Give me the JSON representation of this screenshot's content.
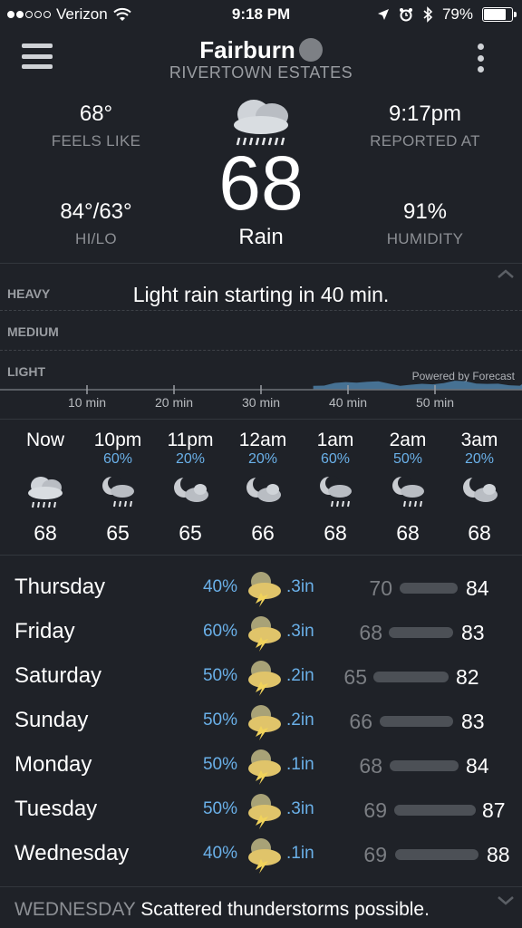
{
  "status_bar": {
    "carrier": "Verizon",
    "time": "9:18 PM",
    "battery": "79%",
    "battery_level": 0.79
  },
  "header": {
    "location": "Fairburn",
    "sublocation": "RIVERTOWN ESTATES"
  },
  "current": {
    "feels_like": {
      "value": "68°",
      "label": "FEELS LIKE"
    },
    "reported_at": {
      "value": "9:17pm",
      "label": "REPORTED AT"
    },
    "hilo": {
      "value": "84°/63°",
      "label": "HI/LO"
    },
    "humidity": {
      "value": "91%",
      "label": "HUMIDITY"
    },
    "temp": "68",
    "condition": "Rain",
    "icon": "rain-cloud-icon"
  },
  "precip_graph": {
    "summary": "Light rain starting in 40 min.",
    "levels": [
      "HEAVY",
      "MEDIUM",
      "LIGHT"
    ],
    "powered_by": "Powered by Forecast",
    "ticks": [
      "10 min",
      "20 min",
      "30 min",
      "40 min",
      "50 min"
    ],
    "intensity_start_min": 36,
    "fill_color": "#4d7fa6"
  },
  "hourly": [
    {
      "time": "Now",
      "precip": "",
      "temp": "68",
      "icon": "rain-cloud-icon"
    },
    {
      "time": "10pm",
      "precip": "60%",
      "temp": "65",
      "icon": "moon-rain-icon"
    },
    {
      "time": "11pm",
      "precip": "20%",
      "temp": "65",
      "icon": "moon-cloud-icon"
    },
    {
      "time": "12am",
      "precip": "20%",
      "temp": "66",
      "icon": "moon-cloud-icon"
    },
    {
      "time": "1am",
      "precip": "60%",
      "temp": "68",
      "icon": "moon-rain-icon"
    },
    {
      "time": "2am",
      "precip": "50%",
      "temp": "68",
      "icon": "moon-rain-icon"
    },
    {
      "time": "3am",
      "precip": "20%",
      "temp": "68",
      "icon": "moon-cloud-icon"
    }
  ],
  "daily": [
    {
      "day": "Thursday",
      "precip": "40%",
      "amount": ".3in",
      "low": "70",
      "high": "84",
      "icon": "storm-icon"
    },
    {
      "day": "Friday",
      "precip": "60%",
      "amount": ".3in",
      "low": "68",
      "high": "83",
      "icon": "storm-icon"
    },
    {
      "day": "Saturday",
      "precip": "50%",
      "amount": ".2in",
      "low": "65",
      "high": "82",
      "icon": "storm-icon"
    },
    {
      "day": "Sunday",
      "precip": "50%",
      "amount": ".2in",
      "low": "66",
      "high": "83",
      "icon": "storm-icon"
    },
    {
      "day": "Monday",
      "precip": "50%",
      "amount": ".1in",
      "low": "68",
      "high": "84",
      "icon": "storm-icon"
    },
    {
      "day": "Tuesday",
      "precip": "50%",
      "amount": ".3in",
      "low": "69",
      "high": "87",
      "icon": "storm-icon"
    },
    {
      "day": "Wednesday",
      "precip": "40%",
      "amount": ".1in",
      "low": "69",
      "high": "88",
      "icon": "storm-icon"
    }
  ],
  "forecast_text": {
    "day": "WEDNESDAY",
    "text": "Scattered thunderstorms possible."
  },
  "colors": {
    "background": "#1f2228",
    "accent_blue": "#6ab0e8",
    "muted": "#8c8f94"
  }
}
